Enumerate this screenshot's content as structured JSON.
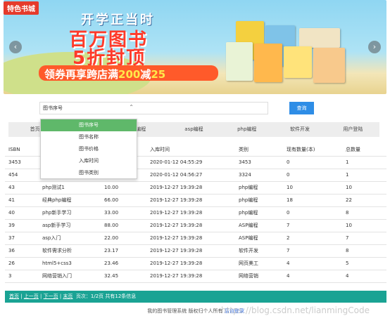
{
  "banner": {
    "tag": "特色书城",
    "line1": "开学正当时",
    "line2": "百万图书",
    "line3": "5折封顶",
    "line4_pre": "领券再享跨店满",
    "line4_num": "200",
    "line4_mid": "减",
    "line4_end": "25",
    "prev": "‹",
    "next": "›"
  },
  "search": {
    "select_value": "图书序号",
    "button": "查询"
  },
  "nav": [
    "首页",
    "",
    "编程",
    "asp编程",
    "php编程",
    "软件开发",
    "用户登陆"
  ],
  "dropdown": [
    "图书序号",
    "图书名称",
    "图书价格",
    "入库时间",
    "图书类别"
  ],
  "table": {
    "headers": [
      "ISBN",
      "",
      "",
      "入库时间",
      "类别",
      "现有数量(本)",
      "总数量"
    ],
    "rows": [
      [
        "3453",
        "",
        "",
        "2020-01-12 04:55:29",
        "3453",
        "0",
        "1"
      ],
      [
        "454",
        "",
        "",
        "2020-01-12 04:56:27",
        "3324",
        "0",
        "1"
      ],
      [
        "43",
        "php测试1",
        "10.00",
        "2019-12-27 19:39:28",
        "php编程",
        "10",
        "10"
      ],
      [
        "41",
        "经典php编程",
        "66.00",
        "2019-12-27 19:39:28",
        "php编程",
        "18",
        "22"
      ],
      [
        "40",
        "php新手学习",
        "33.00",
        "2019-12-27 19:39:28",
        "php编程",
        "0",
        "8"
      ],
      [
        "39",
        "asp新手学习",
        "88.00",
        "2019-12-27 19:39:28",
        "ASP编程",
        "7",
        "10"
      ],
      [
        "37",
        "asp入门",
        "22.00",
        "2019-12-27 19:39:28",
        "ASP编程",
        "2",
        "7"
      ],
      [
        "36",
        "软件需求分析",
        "23.17",
        "2019-12-27 19:39:28",
        "软件开发",
        "7",
        "8"
      ],
      [
        "26",
        "html5+css3",
        "23.46",
        "2019-12-27 19:39:28",
        "网页美工",
        "4",
        "5"
      ],
      [
        "3",
        "网络营销入门",
        "32.45",
        "2019-12-27 19:39:28",
        "网络营销",
        "4",
        "4"
      ]
    ]
  },
  "pager": {
    "first": "首页",
    "prev": "上一页",
    "next": "下一页",
    "last": "末页",
    "info": "页次：1/2页 共有12条信息"
  },
  "footer": {
    "text": "我的图书管理系统 版权归个人所有",
    "link": "后台登录"
  },
  "watermark": "https://blog.csdn.net/lianmingCode",
  "colors": {
    "accent": "#1aa394",
    "button": "#2e8de6",
    "highlight": "#5fb86a"
  }
}
